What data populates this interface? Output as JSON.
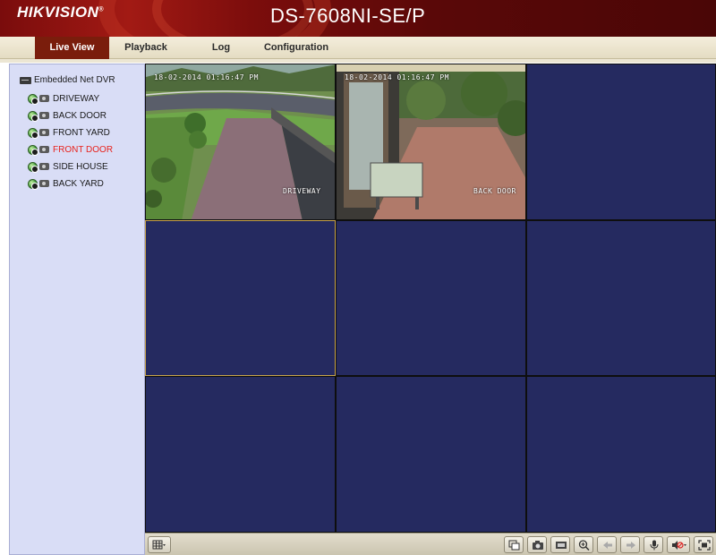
{
  "header": {
    "brand": "HIKVISION",
    "model": "DS-7608NI-SE/P"
  },
  "nav": {
    "tabs": [
      {
        "label": "Live View",
        "active": true
      },
      {
        "label": "Playback",
        "active": false
      },
      {
        "label": "Log",
        "active": false
      },
      {
        "label": "Configuration",
        "active": false
      }
    ]
  },
  "sidebar": {
    "root_label": "Embedded Net DVR",
    "cameras": [
      {
        "label": "DRIVEWAY",
        "selected": false
      },
      {
        "label": "BACK DOOR",
        "selected": false
      },
      {
        "label": "FRONT YARD",
        "selected": false
      },
      {
        "label": "FRONT DOOR",
        "selected": true
      },
      {
        "label": "SIDE HOUSE",
        "selected": false
      },
      {
        "label": "BACK YARD",
        "selected": false
      }
    ]
  },
  "grid": {
    "layout": "3x3",
    "feeds": [
      {
        "timestamp": "18-02-2014 01:16:47 PM",
        "name": "DRIVEWAY"
      },
      {
        "timestamp": "18-02-2014 01:16:47 PM",
        "name": "BACK DOOR"
      }
    ]
  },
  "toolbar": {
    "icons": [
      "layout-grid-icon",
      "stop-all-icon",
      "snapshot-icon",
      "record-icon",
      "zoom-icon",
      "prev-page-icon",
      "next-page-icon",
      "microphone-icon",
      "volume-icon",
      "fullscreen-icon"
    ]
  },
  "colors": {
    "header_red": "#7a0c0c",
    "active_tab": "#7a1d0c",
    "sidebar_bg": "#d9ddf6",
    "empty_cell": "#252a60",
    "selected_text": "#e8231d",
    "active_cell_border": "#c9a44c"
  }
}
